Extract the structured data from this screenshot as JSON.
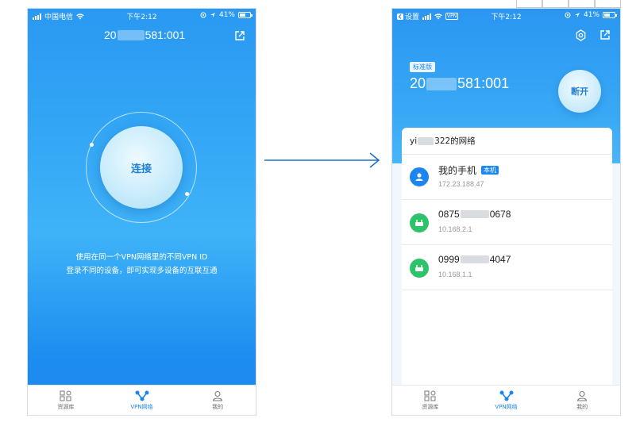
{
  "left_phone": {
    "status": {
      "carrier": "中国电信",
      "time": "下午2:12",
      "battery": "41%"
    },
    "device_id": {
      "prefix": "20",
      "suffix": "581:001"
    },
    "connect_label": "连接",
    "hint_line1": "使用在同一个VPN网络里的不同VPN ID",
    "hint_line2": "登录不同的设备，即可实现多设备的互联互通"
  },
  "right_phone": {
    "status": {
      "back_label": "设置",
      "vpn_badge": "VPN",
      "time": "下午2:12",
      "battery": "41%"
    },
    "edition": "标准版",
    "device_id": {
      "prefix": "20",
      "suffix": "581:001"
    },
    "disconnect_label": "断开",
    "network": {
      "prefix": "yi",
      "suffix": "322的网络"
    },
    "devices": [
      {
        "name": "我的手机",
        "badge": "本机",
        "ip": "172.23.188.47",
        "icon": "user-icon",
        "color": "#1b86ee"
      },
      {
        "name_prefix": "0875",
        "name_suffix": "0678",
        "ip": "10.168.2.1",
        "icon": "router-icon",
        "color": "#2dc36b"
      },
      {
        "name_prefix": "0999",
        "name_suffix": "4047",
        "ip": "10.168.1.1",
        "icon": "router-icon",
        "color": "#2dc36b"
      }
    ]
  },
  "tabs": [
    {
      "label": "资源库",
      "icon": "apps-icon"
    },
    {
      "label": "VPN网络",
      "icon": "vpn-network-icon"
    },
    {
      "label": "我的",
      "icon": "profile-icon"
    }
  ],
  "colors": {
    "primary": "#1b86ee",
    "router_green": "#2dc36b"
  }
}
